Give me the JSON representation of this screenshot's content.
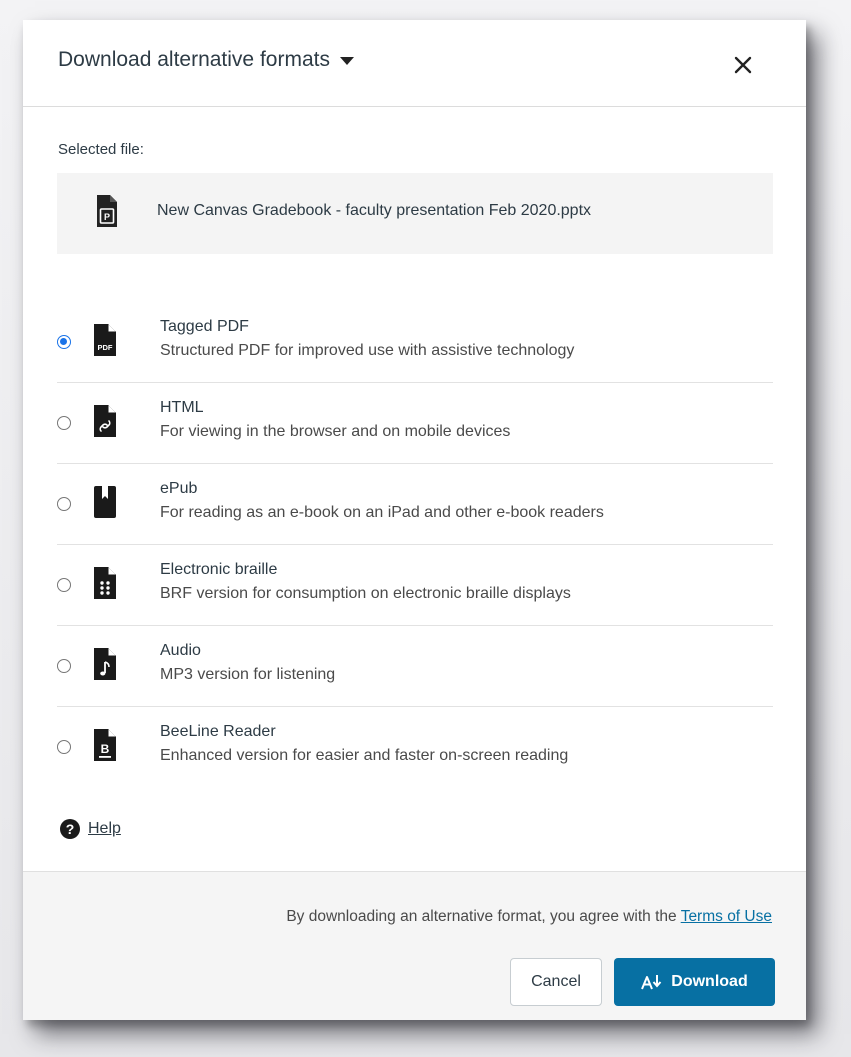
{
  "dialog": {
    "title": "Download alternative formats",
    "close_icon": "close-icon"
  },
  "selected_file": {
    "label": "Selected file:",
    "name": "New Canvas Gradebook - faculty presentation Feb 2020.pptx",
    "icon": "pptx-file-icon"
  },
  "formats": [
    {
      "name": "Tagged PDF",
      "description": "Structured PDF for improved use with assistive technology",
      "selected": true,
      "icon": "pdf-file-icon"
    },
    {
      "name": "HTML",
      "description": "For viewing in the browser and on mobile devices",
      "selected": false,
      "icon": "html-link-icon"
    },
    {
      "name": "ePub",
      "description": "For reading as an e-book on an iPad and other e-book readers",
      "selected": false,
      "icon": "epub-book-icon"
    },
    {
      "name": "Electronic braille",
      "description": "BRF version for consumption on electronic braille displays",
      "selected": false,
      "icon": "braille-icon"
    },
    {
      "name": "Audio",
      "description": "MP3 version for listening",
      "selected": false,
      "icon": "audio-note-icon"
    },
    {
      "name": "BeeLine Reader",
      "description": "Enhanced version for easier and faster on-screen reading",
      "selected": false,
      "icon": "beeline-icon"
    }
  ],
  "help": {
    "label": "Help"
  },
  "footer": {
    "agreement_prefix": "By downloading an alternative format, you agree with the ",
    "terms_label": "Terms of Use",
    "cancel_label": "Cancel",
    "download_label": "Download"
  },
  "colors": {
    "accent": "#0770a3",
    "radio_selected": "#1a73e8",
    "text": "#2d3b45",
    "footer_bg": "#f5f5f5"
  }
}
